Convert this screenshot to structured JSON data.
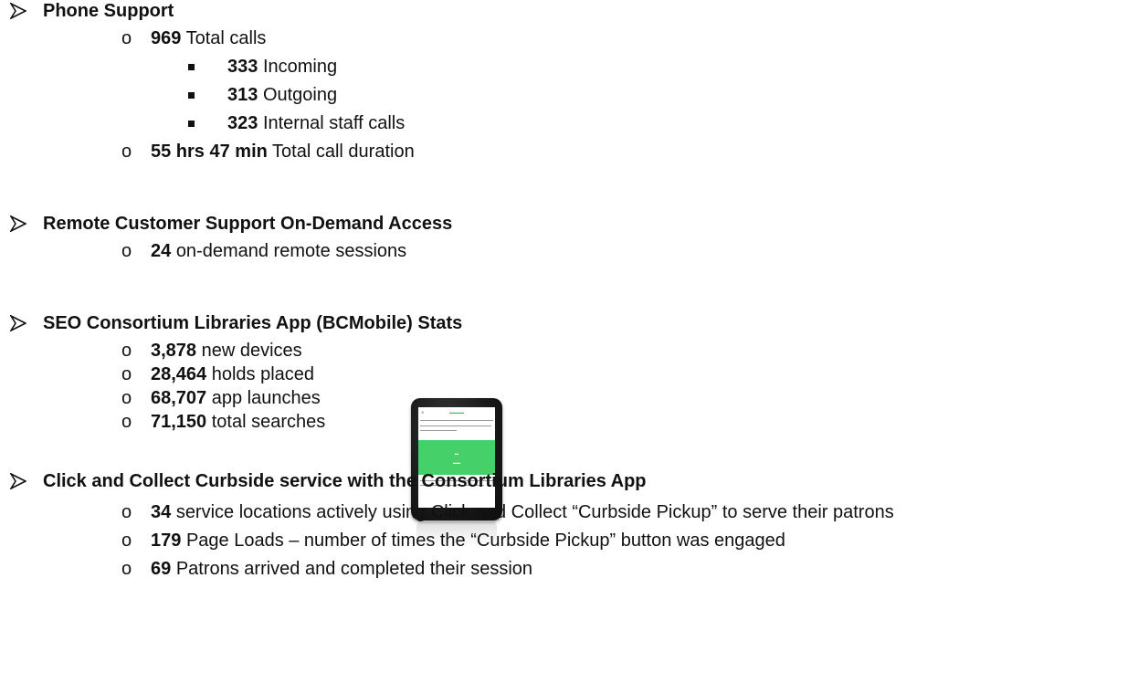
{
  "sections": [
    {
      "title": "Phone Support",
      "items": [
        {
          "value": "969",
          "label": "Total calls",
          "sub": [
            {
              "value": "333",
              "label": "Incoming"
            },
            {
              "value": "313",
              "label": "Outgoing"
            },
            {
              "value": "323",
              "label": "Internal staff calls"
            }
          ]
        },
        {
          "value": "55 hrs 47 min",
          "label": "Total call duration"
        }
      ]
    },
    {
      "title": "Remote Customer Support On-Demand Access",
      "items": [
        {
          "value": "24",
          "label": "on-demand remote sessions"
        }
      ]
    },
    {
      "title": "SEO Consortium Libraries App (BCMobile) Stats",
      "items": [
        {
          "value": "3,878",
          "label": "new devices"
        },
        {
          "value": "28,464",
          "label": "holds placed"
        },
        {
          "value": "68,707",
          "label": "app launches"
        },
        {
          "value": "71,150",
          "label": "total searches"
        }
      ]
    },
    {
      "title": "Click and Collect Curbside service with the Consortium Libraries App",
      "items": [
        {
          "value": "34",
          "label": "service locations actively using Click and Collect “Curbside Pickup” to serve their patrons"
        },
        {
          "value": "179",
          "label": "Page Loads – number of times the “Curbside Pickup” button was engaged"
        },
        {
          "value": "69",
          "label": "Patrons arrived and completed their session"
        }
      ]
    }
  ],
  "bullets": {
    "level2": "o"
  },
  "colors": {
    "text": "#111111",
    "app_green": "#46d06a",
    "device_body": "#1a1a1a"
  },
  "device_image": {
    "icon": "tablet-device-image"
  }
}
